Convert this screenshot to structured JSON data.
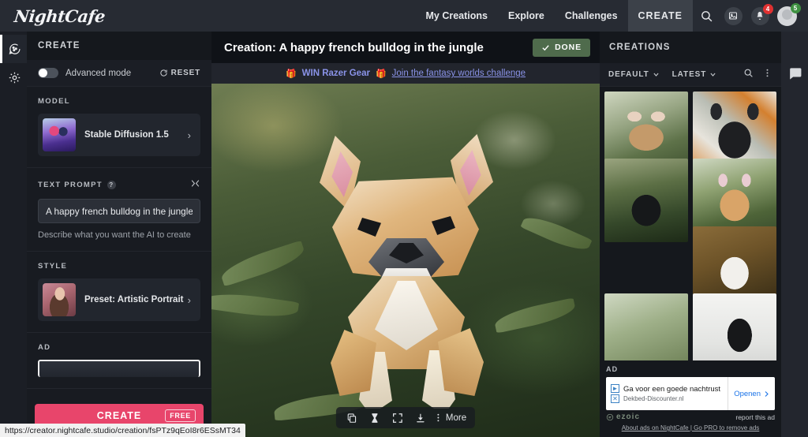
{
  "topbar": {
    "logo": "NightCafe",
    "nav": [
      {
        "label": "My Creations"
      },
      {
        "label": "Explore"
      },
      {
        "label": "Challenges"
      }
    ],
    "create_label": "CREATE",
    "search_icon": "search-icon",
    "gallery_icon": "image-icon",
    "bell_icon": "bell-icon",
    "bell_badge": "4",
    "avatar_badge": "5"
  },
  "rail": {
    "items": [
      {
        "name": "create-palette-icon",
        "active": true
      },
      {
        "name": "settings-gear-icon",
        "active": false
      }
    ]
  },
  "left_panel": {
    "header": "CREATE",
    "advanced_mode_label": "Advanced mode",
    "advanced_mode_on": false,
    "reset_label": "RESET",
    "model": {
      "section_title": "MODEL",
      "value": "Stable Diffusion 1.5"
    },
    "text_prompt": {
      "section_title": "TEXT PROMPT",
      "value": "A happy french bulldog in the jungle",
      "placeholder": "A happy french bulldog in the jungle",
      "hint": "Describe what you want the AI to create"
    },
    "style": {
      "section_title": "STYLE",
      "value": "Preset: Artistic Portrait"
    },
    "ad": {
      "section_title": "AD"
    },
    "create_button": {
      "label": "CREATE",
      "badge": "FREE",
      "color": "#e8456b"
    }
  },
  "center": {
    "title": "Creation: A happy french bulldog in the jungle",
    "done_label": "DONE",
    "done_color": "#4f6b4c",
    "banner": {
      "emoji_left": "🎁",
      "text": "WIN Razer Gear",
      "emoji_right": "🎁",
      "link": "Join the fantasy worlds challenge",
      "link_color": "#8a93e8"
    },
    "toolbar": {
      "copy_icon": "copy-icon",
      "evolve_icon": "hourglass-icon",
      "fullscreen_icon": "fullscreen-icon",
      "download_icon": "download-icon",
      "more_label": "More"
    }
  },
  "right_panel": {
    "header": "CREATIONS",
    "gallery_icon": "gallery-stack-icon",
    "filters": [
      {
        "label": "DEFAULT"
      },
      {
        "label": "LATEST"
      }
    ],
    "search_icon": "search-icon",
    "menu_icon": "kebab-menu-icon",
    "thumbnails": [
      {
        "alt": "tan french bulldog in jungle"
      },
      {
        "alt": "black french bulldog illustration with orange leaves"
      },
      {
        "alt": "black french bulldog in dark jungle"
      },
      {
        "alt": "origami tan french bulldog on moss"
      },
      {
        "alt": "french bulldog with pink flowers in jungle"
      },
      {
        "alt": "white french bulldog on gold fabric"
      },
      {
        "alt": "pale green jungle scene"
      },
      {
        "alt": "white background bulldog closeup"
      }
    ],
    "ad": {
      "label": "AD",
      "headline": "Ga voor een goede nachtrust",
      "domain": "Dekbed-Discounter.nl",
      "cta": "Openen",
      "provider": "ezoic",
      "report": "report this ad",
      "footer_links": "About ads on NightCafe | Go PRO to remove ads"
    }
  },
  "far_rail": {
    "chat_icon": "chat-bubble-icon"
  },
  "status_bar": {
    "url": "https://creator.nightcafe.studio/creation/fsPTz9qEoI8r6ESsMT34"
  }
}
